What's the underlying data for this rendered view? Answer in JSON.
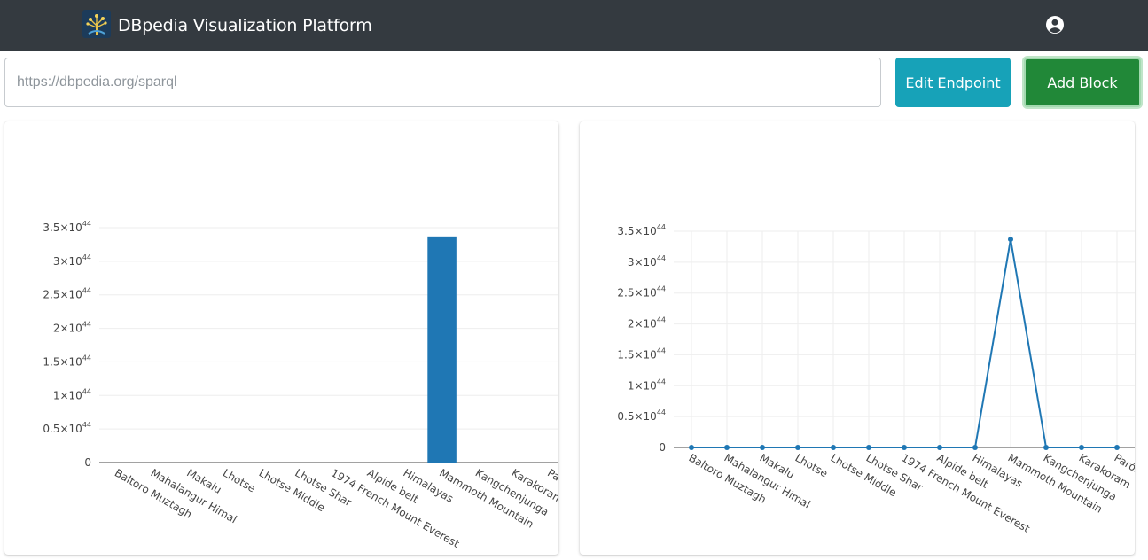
{
  "navbar": {
    "brand": "DBpedia Visualization Platform",
    "logo_icon": "dbpedia-tree-logo",
    "user_icon": "user-circle-icon",
    "background": "#343a40"
  },
  "endpoint": {
    "placeholder": "https://dbpedia.org/sparql",
    "value": ""
  },
  "toolbar": {
    "edit_endpoint_label": "Edit Endpoint",
    "add_block_label": "Add Block",
    "edit_color": "#17a2b8",
    "add_color": "#218838"
  },
  "chart_data": [
    {
      "type": "bar",
      "title": "",
      "xlabel": "",
      "ylabel": "",
      "categories": [
        "Baltoro Muztagh",
        "Mahalangur Himal",
        "Makalu",
        "Lhotse",
        "Lhotse Middle",
        "Lhotse Shar",
        "1974 French Mount Everest",
        "Alpide belt",
        "Himalayas",
        "Mammoth Mountain",
        "Kangchenjunga",
        "Karakoram",
        "Parón"
      ],
      "values": [
        0,
        0,
        0,
        0,
        0,
        0,
        0,
        0,
        0,
        3.37e+44,
        0,
        0,
        0
      ],
      "ylim": [
        0,
        3.5e+44
      ],
      "yticks": [
        0,
        5e+43,
        1e+44,
        1.5e+44,
        2e+44,
        2.5e+44,
        3e+44,
        3.5e+44
      ],
      "ytick_labels": [
        {
          "mantissa": "0",
          "exp": ""
        },
        {
          "mantissa": "0.5×10",
          "exp": "44"
        },
        {
          "mantissa": "1×10",
          "exp": "44"
        },
        {
          "mantissa": "1.5×10",
          "exp": "44"
        },
        {
          "mantissa": "2×10",
          "exp": "44"
        },
        {
          "mantissa": "2.5×10",
          "exp": "44"
        },
        {
          "mantissa": "3×10",
          "exp": "44"
        },
        {
          "mantissa": "3.5×10",
          "exp": "44"
        }
      ],
      "grid": true,
      "color": "#1f77b4"
    },
    {
      "type": "line",
      "title": "",
      "xlabel": "",
      "ylabel": "",
      "categories": [
        "Baltoro Muztagh",
        "Mahalangur Himal",
        "Makalu",
        "Lhotse",
        "Lhotse Middle",
        "Lhotse Shar",
        "1974 French Mount Everest",
        "Alpide belt",
        "Himalayas",
        "Mammoth Mountain",
        "Kangchenjunga",
        "Karakoram",
        "Parón"
      ],
      "values": [
        0,
        0,
        0,
        0,
        0,
        0,
        0,
        0,
        0,
        3.37e+44,
        0,
        0,
        0
      ],
      "ylim": [
        0,
        3.5e+44
      ],
      "yticks": [
        0,
        5e+43,
        1e+44,
        1.5e+44,
        2e+44,
        2.5e+44,
        3e+44,
        3.5e+44
      ],
      "ytick_labels": [
        {
          "mantissa": "0",
          "exp": ""
        },
        {
          "mantissa": "0.5×10",
          "exp": "44"
        },
        {
          "mantissa": "1×10",
          "exp": "44"
        },
        {
          "mantissa": "1.5×10",
          "exp": "44"
        },
        {
          "mantissa": "2×10",
          "exp": "44"
        },
        {
          "mantissa": "2.5×10",
          "exp": "44"
        },
        {
          "mantissa": "3×10",
          "exp": "44"
        },
        {
          "mantissa": "3.5×10",
          "exp": "44"
        }
      ],
      "grid": true,
      "color": "#1f77b4"
    }
  ]
}
